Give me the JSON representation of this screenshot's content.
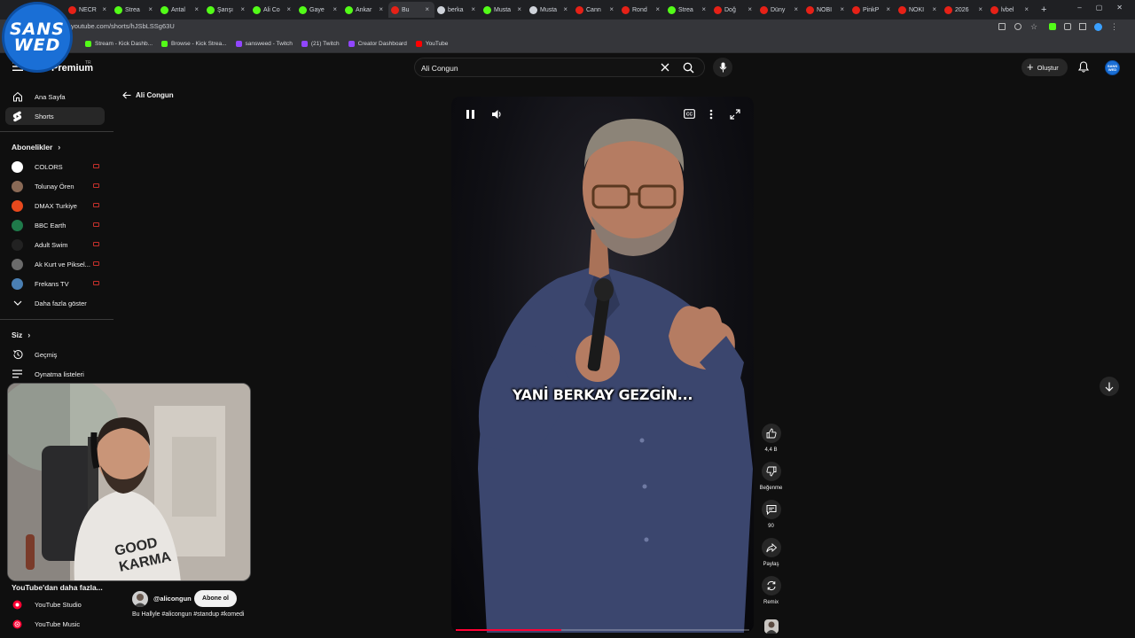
{
  "browser": {
    "tabs": [
      {
        "label": "NECR",
        "color": "#e62117"
      },
      {
        "label": "Strea",
        "color": "#53fc18"
      },
      {
        "label": "Antal",
        "color": "#53fc18"
      },
      {
        "label": "Şanşı",
        "color": "#53fc18"
      },
      {
        "label": "Ali Co",
        "color": "#53fc18"
      },
      {
        "label": "Gaye",
        "color": "#53fc18"
      },
      {
        "label": "Ankar",
        "color": "#53fc18"
      },
      {
        "label": "Bu",
        "color": "#e62117",
        "active": true
      },
      {
        "label": "berka",
        "color": "#cfd3da"
      },
      {
        "label": "Musta",
        "color": "#53fc18"
      },
      {
        "label": "Musta",
        "color": "#cfd3da"
      },
      {
        "label": "Cann",
        "color": "#e62117"
      },
      {
        "label": "Rond",
        "color": "#e62117"
      },
      {
        "label": "Strea",
        "color": "#53fc18"
      },
      {
        "label": "Doğ",
        "color": "#e62117"
      },
      {
        "label": "Düny",
        "color": "#e62117"
      },
      {
        "label": "NOBI",
        "color": "#e62117"
      },
      {
        "label": "PinkP",
        "color": "#e62117"
      },
      {
        "label": "NOKI",
        "color": "#e62117"
      },
      {
        "label": "2026",
        "color": "#e62117"
      },
      {
        "label": "lvbel",
        "color": "#e62117"
      }
    ],
    "url": "youtube.com/shorts/hJSbLSSg63U",
    "bookmarks": [
      {
        "label": "Stream - Kick Dashb...",
        "color": "#53fc18"
      },
      {
        "label": "Browse - Kick Strea...",
        "color": "#53fc18"
      },
      {
        "label": "sansweed - Twitch",
        "color": "#9146ff"
      },
      {
        "label": "(21) Twitch",
        "color": "#9146ff"
      },
      {
        "label": "Creator Dashboard",
        "color": "#9146ff"
      },
      {
        "label": "YouTube",
        "color": "#ff0000"
      }
    ]
  },
  "stream_logo": {
    "line1": "SANS",
    "line2": "WED"
  },
  "header": {
    "logo": "Premium",
    "logo_sup": "TR",
    "search_value": "Ali Congun",
    "create_label": "Oluştur",
    "avatar_text": "SANS WED"
  },
  "sidebar": {
    "main": [
      {
        "label": "Ana Sayfa",
        "icon": "home-icon"
      },
      {
        "label": "Shorts",
        "icon": "shorts-icon",
        "active": true
      }
    ],
    "subscriptions_title": "Abonelikler",
    "subscriptions": [
      {
        "label": "COLORS",
        "avatar": "#ffffff"
      },
      {
        "label": "Tolunay Ören",
        "avatar": "#8a6a56"
      },
      {
        "label": "DMAX Turkiye",
        "avatar": "#e8491d"
      },
      {
        "label": "BBC Earth",
        "avatar": "#1f7a4a"
      },
      {
        "label": "Adult Swim",
        "avatar": "#222222"
      },
      {
        "label": "Ak Kurt ve Piksel...",
        "avatar": "#6b6b6b"
      },
      {
        "label": "Frekans TV",
        "avatar": "#4a7fb3"
      }
    ],
    "show_more": "Daha fazla göster",
    "you_title": "Siz",
    "you_items": [
      {
        "label": "Geçmiş",
        "icon": "history-icon"
      },
      {
        "label": "Oynatma listeleri",
        "icon": "playlists-icon"
      }
    ],
    "more_from_youtube": "YouTube'dan daha fazla...",
    "yt_apps": [
      {
        "label": "YouTube Studio"
      },
      {
        "label": "YouTube Music"
      }
    ]
  },
  "back_label": "Ali Congun",
  "video": {
    "caption": "YANİ BERKAY GEZGİN...",
    "progress": 0.36
  },
  "actions": {
    "like_count": "4,4 B",
    "dislike_label": "Beğenme",
    "comments_count": "90",
    "share_label": "Paylaş",
    "remix_label": "Remix"
  },
  "channel": {
    "handle": "@alicongun",
    "subscribe_label": "Abone ol",
    "description": "Bu Hallyle #alicongun #standup #komedi"
  },
  "colors": {
    "accent": "#ff0033",
    "background": "#0f0f0f"
  }
}
